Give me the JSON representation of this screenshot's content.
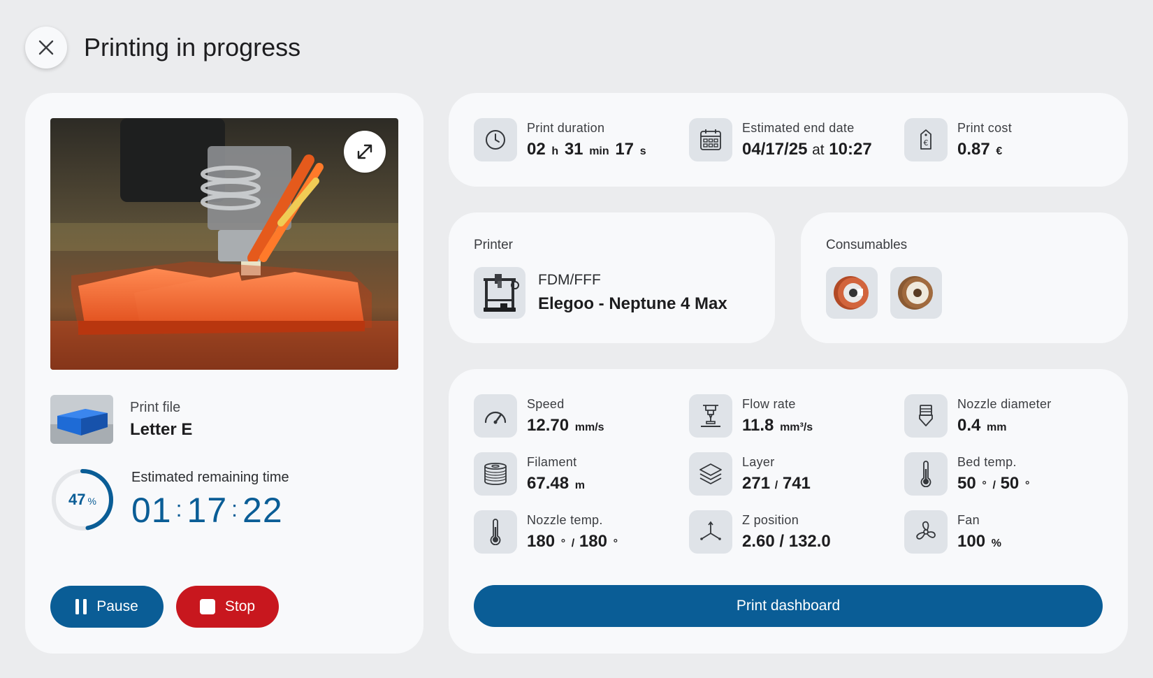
{
  "header": {
    "title": "Printing in progress"
  },
  "left": {
    "file_label": "Print file",
    "file_name": "Letter E",
    "progress_percent": 47,
    "progress_unit": "%",
    "remaining_label": "Estimated remaining time",
    "remaining": {
      "h": "01",
      "m": "17",
      "s": "22",
      "colon": ":"
    },
    "pause_label": "Pause",
    "stop_label": "Stop"
  },
  "summary": {
    "duration": {
      "label": "Print duration",
      "h": "02",
      "h_unit": "h",
      "m": "31",
      "m_unit": "min",
      "s": "17",
      "s_unit": "s"
    },
    "end": {
      "label": "Estimated end date",
      "date": "04/17/25",
      "at": "at",
      "time": "10:27"
    },
    "cost": {
      "label": "Print cost",
      "value": "0.87",
      "unit": "€"
    }
  },
  "printer": {
    "label": "Printer",
    "type": "FDM/FFF",
    "name": "Elegoo - Neptune 4 Max"
  },
  "consumables": {
    "label": "Consumables",
    "spool_colors": [
      "#d2643c",
      "#efe9dc"
    ]
  },
  "stats": {
    "speed": {
      "label": "Speed",
      "value": "12.70",
      "unit": "mm/s"
    },
    "flow": {
      "label": "Flow rate",
      "value": "11.8",
      "unit": "mm³/s"
    },
    "nozzle_diameter": {
      "label": "Nozzle diameter",
      "value": "0.4",
      "unit": "mm"
    },
    "filament": {
      "label": "Filament",
      "value": "67.48",
      "unit": "m"
    },
    "layer": {
      "label": "Layer",
      "current": "271",
      "sep": "/",
      "total": "741"
    },
    "bed_temp": {
      "label": "Bed temp.",
      "current": "50",
      "target": "50",
      "deg": "°",
      "sep": "/"
    },
    "nozzle_temp": {
      "label": "Nozzle temp.",
      "current": "180",
      "target": "180",
      "deg": "°",
      "sep": "/"
    },
    "z": {
      "label": "Z position",
      "value": "2.60 / 132.0"
    },
    "fan": {
      "label": "Fan",
      "value": "100",
      "unit": "%"
    }
  },
  "dashboard_label": "Print dashboard",
  "colors": {
    "primary": "#0a5d96",
    "danger": "#c8171e",
    "card": "#f8f9fb",
    "background": "#ebecee",
    "icon_bg": "#dfe3e8"
  }
}
